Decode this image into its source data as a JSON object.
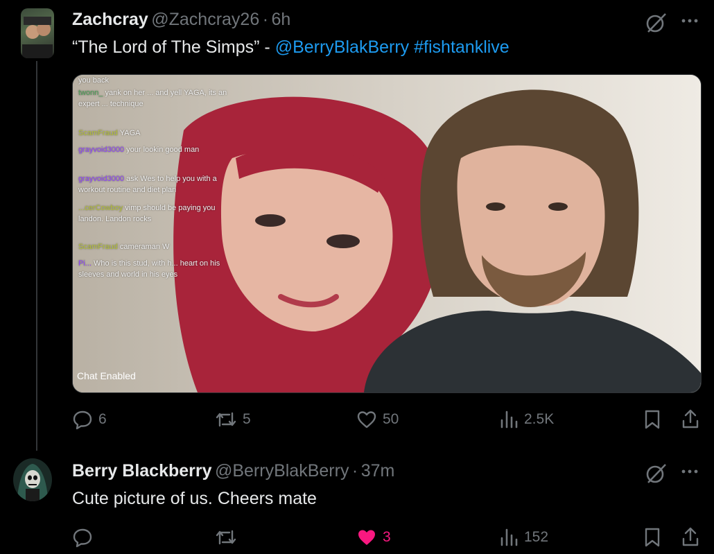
{
  "tweet1": {
    "display_name": "Zachcray",
    "handle": "@Zachcray26",
    "separator": "·",
    "time": "6h",
    "text_prefix": "“The Lord of The Simps” - ",
    "mention": "@BerryBlakBerry",
    "hashtag": "#fishtanklive",
    "media": {
      "chat_lines": [
        {
          "user": "",
          "text": "you back"
        },
        {
          "user": "twonn_",
          "text": "yank on her ... and yell YAGA, its an expert ... technique"
        },
        {
          "user": "ScamFraud",
          "text": "YAGA"
        },
        {
          "user": "grayvoid3000",
          "text": "your lookin good man"
        },
        {
          "user": "grayvoid3000",
          "text": "ask Wes to help you with a workout routine and diet plan"
        },
        {
          "user": "...cerCowboy",
          "text": "vimp should be paying you landon. Landon rocks"
        },
        {
          "user": "ScamFraud",
          "text": "cameraman W"
        },
        {
          "user": "Pi...",
          "text": "Who is this stud, with h... heart on his sleeves and world in his eyes"
        }
      ],
      "overlay_label": "Chat Enabled"
    },
    "actions": {
      "replies": "6",
      "reposts": "5",
      "likes": "50",
      "views": "2.5K"
    }
  },
  "tweet2": {
    "display_name": "Berry Blackberry",
    "handle": "@BerryBlakBerry",
    "separator": "·",
    "time": "37m",
    "text": "Cute picture of us. Cheers mate",
    "actions": {
      "replies": "",
      "reposts": "",
      "likes": "3",
      "views": "152"
    }
  },
  "colors": {
    "background": "#000000",
    "text_primary": "#e7e9ea",
    "text_secondary": "#71767b",
    "link": "#1d9bf0",
    "like_active": "#f91880"
  },
  "icons": [
    "grok-icon",
    "more-icon",
    "reply-icon",
    "repost-icon",
    "like-icon",
    "views-icon",
    "bookmark-icon",
    "share-icon"
  ]
}
